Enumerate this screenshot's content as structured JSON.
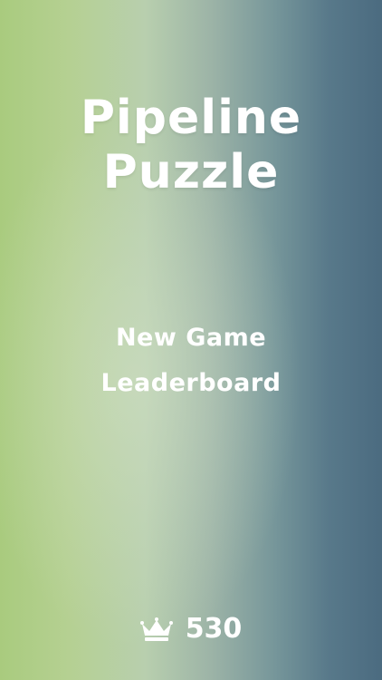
{
  "title": {
    "line1": "Pipeline",
    "line2": "Puzzle"
  },
  "menu": {
    "items": [
      {
        "label": "New Game"
      },
      {
        "label": "Leaderboard"
      }
    ]
  },
  "best_score": {
    "icon": "crown-icon",
    "value": "530"
  },
  "colors": {
    "background_left": "#a9cb7e",
    "background_right": "#4b6b80",
    "text": "#ffffff"
  }
}
